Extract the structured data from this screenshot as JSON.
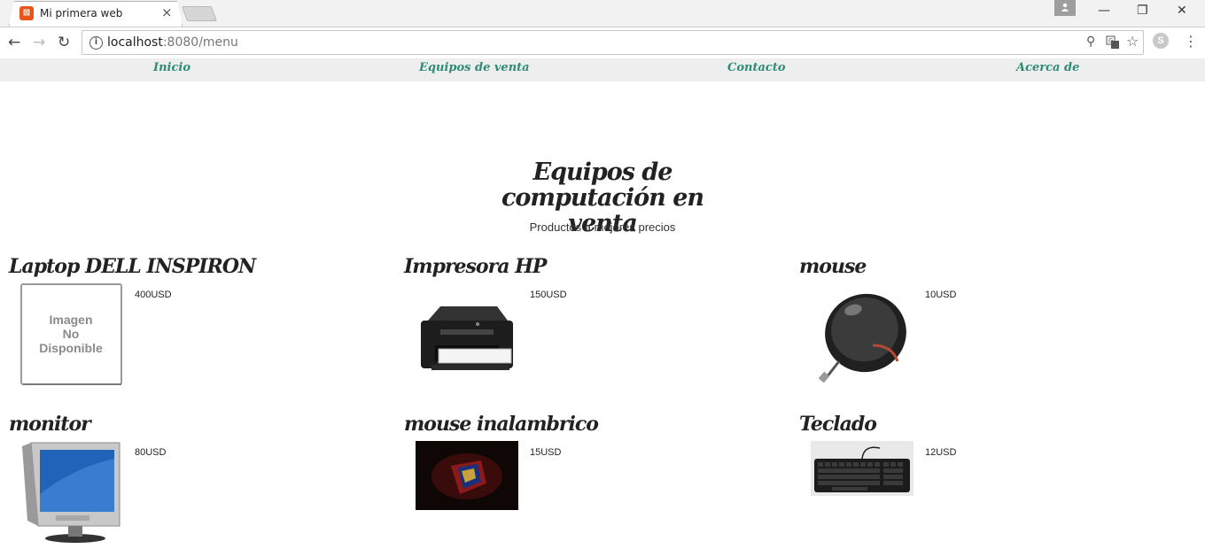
{
  "browser": {
    "tab_title": "Mi primera web",
    "tab_close": "×",
    "favicon_glyph": "⊠",
    "url_host": "localhost",
    "url_path": ":8080/menu",
    "back_icon": "←",
    "forward_icon": "→",
    "reload_icon": "↻",
    "zoom_icon": "⚲",
    "star_icon": "☆",
    "menu_icon": "⋮",
    "minimize_icon": "—",
    "restore_icon": "❐",
    "close_icon": "✕",
    "extension_glyph": "S"
  },
  "nav": {
    "items": [
      {
        "label": "Inicio"
      },
      {
        "label": "Equipos de venta"
      },
      {
        "label": "Contacto"
      },
      {
        "label": "Acerca de"
      }
    ],
    "link_color": "#2e8b74"
  },
  "main": {
    "title": "Equipos de computación en venta",
    "subtitle": "Productos a mejores precios",
    "products": [
      {
        "name": "Laptop DELL INSPIRON",
        "price": "400USD",
        "image_icon": "no-image-placeholder",
        "placeholder_text": [
          "Imagen",
          "No",
          "Disponible"
        ]
      },
      {
        "name": "Impresora HP",
        "price": "150USD",
        "image_icon": "printer-image"
      },
      {
        "name": "mouse",
        "price": "10USD",
        "image_icon": "mouse-image"
      },
      {
        "name": "monitor",
        "price": "80USD",
        "image_icon": "monitor-image"
      },
      {
        "name": "mouse inalambrico",
        "price": "15USD",
        "image_icon": "wireless-mouse-image"
      },
      {
        "name": "Teclado",
        "price": "12USD",
        "image_icon": "keyboard-image"
      }
    ]
  }
}
